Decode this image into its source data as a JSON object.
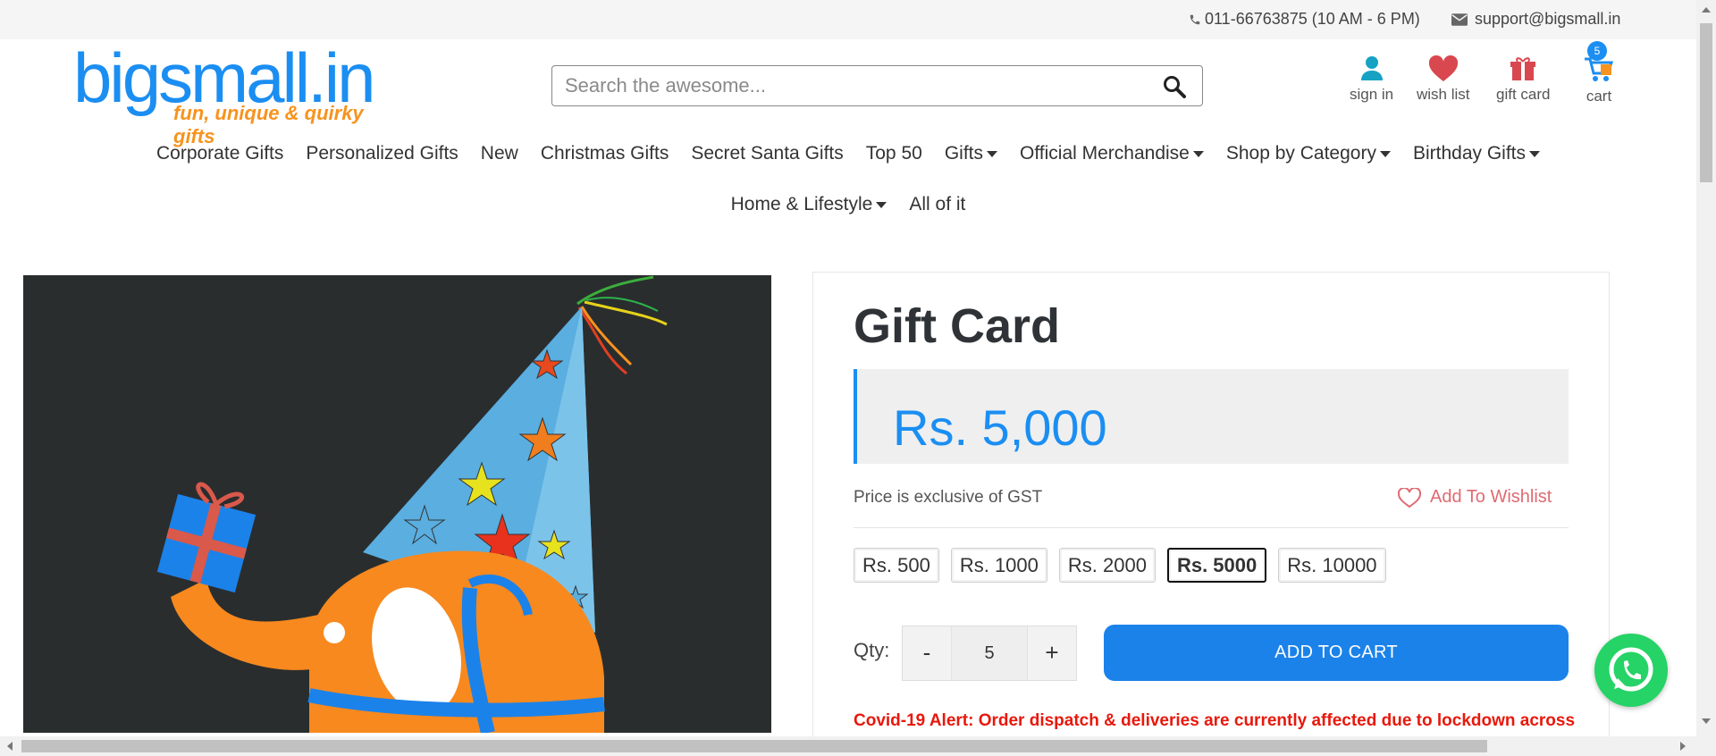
{
  "topbar": {
    "phone": "011-66763875 (10 AM - 6 PM)",
    "email": "support@bigsmall.in"
  },
  "logo": {
    "word": "bigsmall.in",
    "tagline": "fun, unique & quirky gifts"
  },
  "search": {
    "placeholder": "Search the awesome..."
  },
  "header_links": {
    "sign_in": "sign in",
    "wish_list": "wish list",
    "gift_card": "gift card",
    "cart": "cart",
    "cart_count": "5"
  },
  "nav": {
    "row1": [
      {
        "label": "Corporate Gifts"
      },
      {
        "label": "Personalized Gifts"
      },
      {
        "label": "New"
      },
      {
        "label": "Christmas Gifts"
      },
      {
        "label": "Secret Santa Gifts"
      },
      {
        "label": "Top 50"
      },
      {
        "label": "Gifts"
      },
      {
        "label": "Official Merchandise"
      },
      {
        "label": "Shop by Category"
      },
      {
        "label": "Birthday Gifts"
      }
    ],
    "row2": [
      {
        "label": "Home & Lifestyle"
      },
      {
        "label": "All of it"
      }
    ]
  },
  "product": {
    "title": "Gift Card",
    "price": "Rs. 5,000",
    "gst_note": "Price is exclusive of GST",
    "wishlist_label": "Add To Wishlist",
    "denominations": [
      "Rs. 500",
      "Rs. 1000",
      "Rs. 2000",
      "Rs. 5000",
      "Rs. 10000"
    ],
    "selected_denomination": "Rs. 5000",
    "qty_label": "Qty:",
    "qty_minus": "-",
    "qty_value": "5",
    "qty_plus": "+",
    "add_to_cart": "ADD TO CART",
    "alert": "Covid-19 Alert: Order dispatch & deliveries are currently affected due to lockdown across"
  },
  "colors": {
    "brand_blue": "#1b8ef2",
    "brand_orange": "#f7931e",
    "alert_red": "#e8180c",
    "wishlist_pink": "#e06a72",
    "whatsapp_green": "#25d366"
  }
}
